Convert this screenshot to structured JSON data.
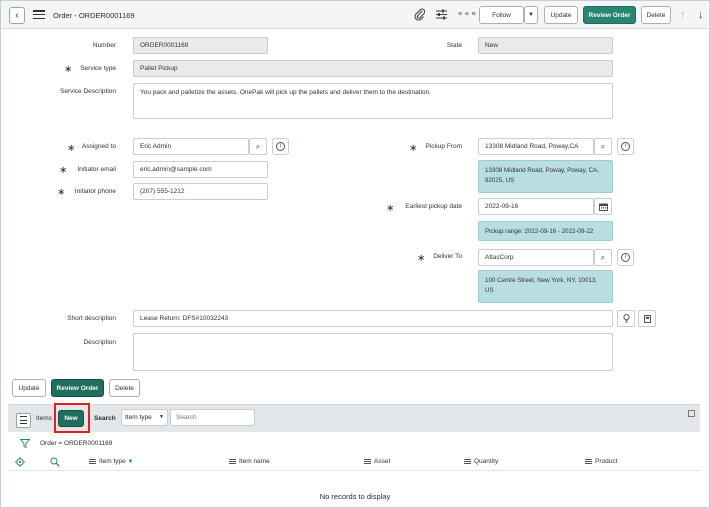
{
  "header": {
    "title": "Order - ORDER0001169",
    "follow_label": "Follow",
    "update_label": "Update",
    "review_order_label": "Review Order",
    "delete_label": "Delete"
  },
  "form": {
    "number_label": "Number",
    "number_value": "ORDER0001169",
    "state_label": "State",
    "state_value": "New",
    "service_type_label": "Service type",
    "service_type_value": "Pallet Pickup",
    "service_description_label": "Service Description",
    "service_description_value": "You pack and palletize the assets.  OnePak will pick up the pallets and deliver them to the destination.",
    "assigned_to_label": "Assigned to",
    "assigned_to_value": "Eric Admin",
    "initiator_email_label": "Initiator email",
    "initiator_email_value": "eric.admin@sample.com",
    "initiator_phone_label": "Initiator phone",
    "initiator_phone_value": "(207) 555-1212",
    "pickup_from_label": "Pickup From",
    "pickup_from_value": "13308 Midland Road, Poway,CA",
    "pickup_from_info": "13308 Midland Road, Poway, Poway, CA, 92025, US",
    "earliest_pickup_label": "Earliest pickup date",
    "earliest_pickup_value": "2022-09-16",
    "pickup_range_info": "Pickup range: 2022-09-16 - 2022-09-22",
    "deliver_to_label": "Deliver To",
    "deliver_to_value": "AtlasCorp",
    "deliver_to_info": "100 Centre Street, New York, NY, 10013, US",
    "short_description_label": "Short description",
    "short_description_value": "Lease Return: DFS#10032243",
    "description_label": "Description",
    "description_value": ""
  },
  "form_buttons": {
    "update_label": "Update",
    "review_order_label": "Review Order",
    "delete_label": "Delete"
  },
  "related_list": {
    "items_label": "Items",
    "new_label": "New",
    "search_label": "Search",
    "search_field_select": "Item type",
    "search_placeholder": "Search",
    "filter_text": "Order = ORDER0001169",
    "columns": [
      "Item type",
      "Item name",
      "Asset",
      "Quantity",
      "Product"
    ],
    "empty_text": "No records to display"
  },
  "colors": {
    "primary": "#278571",
    "info_bg": "#b9dee1",
    "highlight": "#e02020"
  }
}
